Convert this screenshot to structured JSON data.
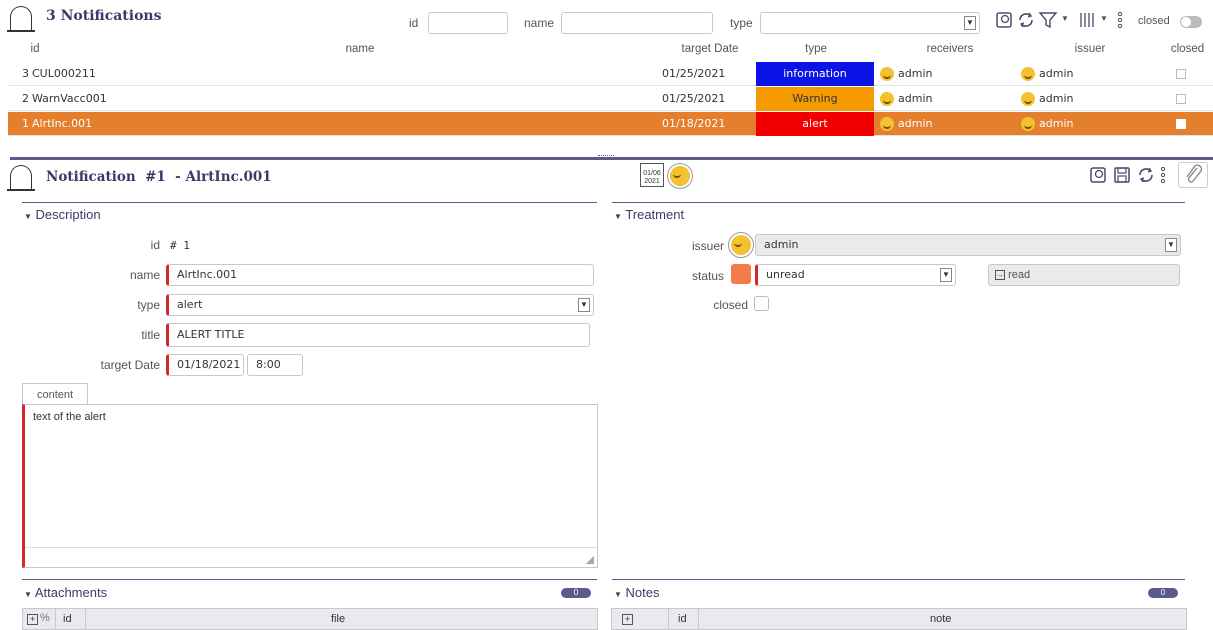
{
  "list": {
    "title": "3 Notifications",
    "filters": {
      "id_label": "id",
      "name_label": "name",
      "type_label": "type",
      "closed_label": "closed",
      "id_value": "",
      "name_value": "",
      "type_value": ""
    },
    "columns": [
      "id",
      "name",
      "target Date",
      "type",
      "receivers",
      "issuer",
      "closed"
    ],
    "rows": [
      {
        "id": "3",
        "name": "CUL000211",
        "date": "01/25/2021",
        "type": "information",
        "type_color": "#0a14e6",
        "receiver": "admin",
        "issuer": "admin",
        "selected": false
      },
      {
        "id": "2",
        "name": "WarnVacc001",
        "date": "01/25/2021",
        "type": "Warning",
        "type_color": "#f59a00",
        "receiver": "admin",
        "issuer": "admin",
        "selected": false
      },
      {
        "id": "1",
        "name": "AlrtInc.001",
        "date": "01/18/2021",
        "type": "alert",
        "type_color": "#f00000",
        "receiver": "admin",
        "issuer": "admin",
        "selected": true
      }
    ]
  },
  "detail": {
    "title": "Notification  #1  - AlrtInc.001",
    "calendar_month_day": "01/06",
    "calendar_year": "2021",
    "description": {
      "section_title": "Description",
      "id_label": "id",
      "id_value": "# 1",
      "name_label": "name",
      "name_value": "AlrtInc.001",
      "type_label": "type",
      "type_value": "alert",
      "title_label": "title",
      "title_value": "ALERT TITLE",
      "date_label": "target Date",
      "date_value": "01/18/2021",
      "time_value": "8:00",
      "content_tab": "content",
      "content_text": "text of the alert"
    },
    "treatment": {
      "section_title": "Treatment",
      "issuer_label": "issuer",
      "issuer_value": "admin",
      "status_label": "status",
      "status_value": "unread",
      "status_color": "#f47c4c",
      "read_button": "read",
      "closed_label": "closed"
    },
    "attachments": {
      "section_title": "Attachments",
      "count": "0",
      "col_id": "id",
      "col_file": "file"
    },
    "notes": {
      "section_title": "Notes",
      "count": "0",
      "col_id": "id",
      "col_note": "note"
    }
  },
  "colors": {
    "accent": "#5a5b8c",
    "selected_row": "#e47f2e",
    "required": "#d9262b"
  },
  "icons": [
    "bell-icon",
    "add-icon",
    "refresh-icon",
    "filter-icon",
    "columns-icon",
    "more-icon",
    "save-icon",
    "attach-icon",
    "calendar-icon",
    "smiley-icon",
    "link-icon",
    "read-icon"
  ]
}
